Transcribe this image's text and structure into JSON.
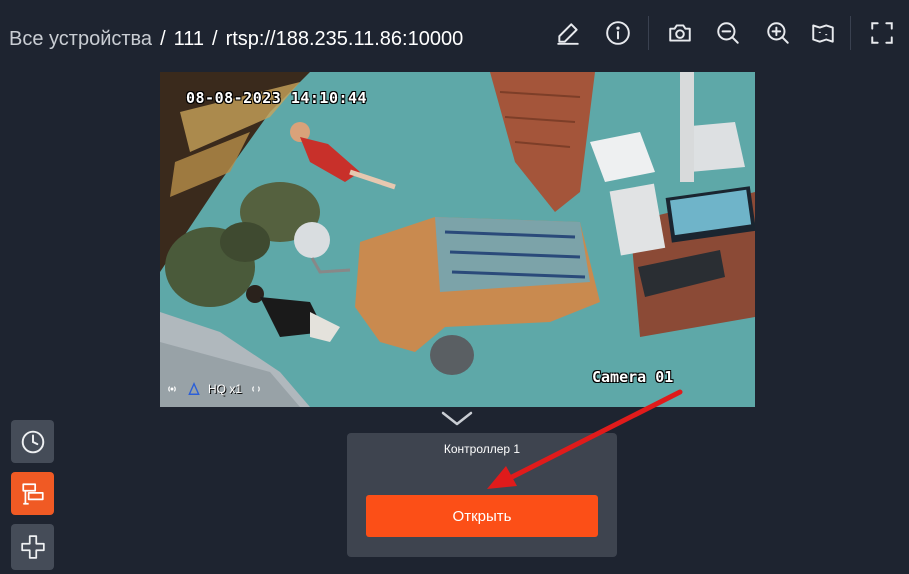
{
  "breadcrumb": {
    "root": "Все устройства",
    "separator": "/",
    "group": "111",
    "device": "rtsp://188.235.11.86:10000"
  },
  "toolbar": {
    "icons": [
      "edit-icon",
      "info-icon",
      "camera-snapshot-icon",
      "zoom-out-icon",
      "zoom-in-icon",
      "map-icon",
      "fullscreen-icon"
    ]
  },
  "video": {
    "timestamp": "08-08-2023 14:10:44",
    "camera_label": "Camera 01",
    "quality_label": "HQ x1"
  },
  "controller_panel": {
    "title": "Контроллер 1",
    "open_button": "Открыть"
  },
  "sidebar": {
    "icons": [
      "clock-icon",
      "controller-icon",
      "ptz-icon"
    ]
  },
  "colors": {
    "background": "#1e2430",
    "accent": "#fc4f17",
    "panel": "#3e444f",
    "annotation_arrow": "#e01b1b"
  }
}
